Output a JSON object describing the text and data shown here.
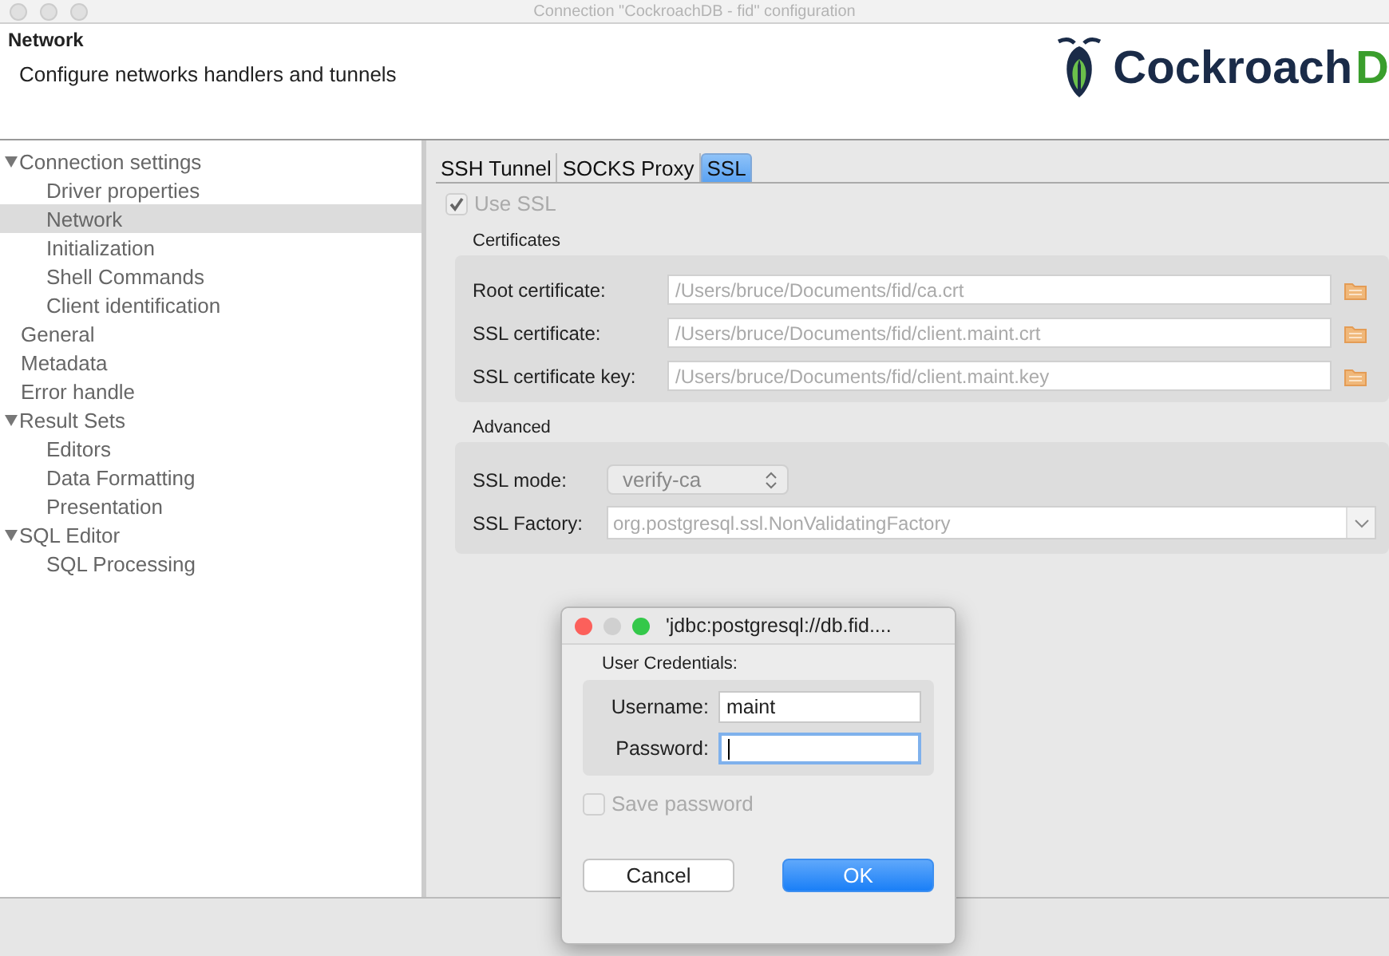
{
  "window": {
    "title": "Connection \"CockroachDB - fid\" configuration"
  },
  "header": {
    "title": "Network",
    "subtitle": "Configure networks handlers and tunnels",
    "logo": {
      "name": "Cockroach",
      "suffix": "D"
    }
  },
  "sidebar": {
    "items": [
      {
        "label": "Connection settings",
        "expanded": true,
        "selected": false,
        "children": [
          {
            "label": "Driver properties",
            "selected": false
          },
          {
            "label": "Network",
            "selected": true
          },
          {
            "label": "Initialization",
            "selected": false
          },
          {
            "label": "Shell Commands",
            "selected": false
          },
          {
            "label": "Client identification",
            "selected": false
          }
        ]
      },
      {
        "label": "General",
        "selected": false
      },
      {
        "label": "Metadata",
        "selected": false
      },
      {
        "label": "Error handle",
        "selected": false
      },
      {
        "label": "Result Sets",
        "expanded": true,
        "selected": false,
        "children": [
          {
            "label": "Editors",
            "selected": false
          },
          {
            "label": "Data Formatting",
            "selected": false
          },
          {
            "label": "Presentation",
            "selected": false
          }
        ]
      },
      {
        "label": "SQL Editor",
        "expanded": true,
        "selected": false,
        "children": [
          {
            "label": "SQL Processing",
            "selected": false
          }
        ]
      }
    ]
  },
  "tabs": [
    {
      "label": "SSH Tunnel",
      "selected": false
    },
    {
      "label": "SOCKS Proxy",
      "selected": false
    },
    {
      "label": "SSL",
      "selected": true
    }
  ],
  "use_ssl": {
    "label": "Use SSL",
    "checked": true,
    "disabled": true
  },
  "certificates": {
    "title": "Certificates",
    "fields": [
      {
        "label": "Root certificate:",
        "value": "/Users/bruce/Documents/fid/ca.crt"
      },
      {
        "label": "SSL certificate:",
        "value": "/Users/bruce/Documents/fid/client.maint.crt"
      },
      {
        "label": "SSL certificate key:",
        "value": "/Users/bruce/Documents/fid/client.maint.key"
      }
    ]
  },
  "advanced": {
    "title": "Advanced",
    "ssl_mode": {
      "label": "SSL mode:",
      "value": "verify-ca"
    },
    "ssl_factory": {
      "label": "SSL Factory:",
      "value": "org.postgresql.ssl.NonValidatingFactory"
    }
  },
  "dialog": {
    "title": "'jdbc:postgresql://db.fid....",
    "group": "User Credentials:",
    "username": {
      "label": "Username:",
      "value": "maint"
    },
    "password": {
      "label": "Password:",
      "focused": true
    },
    "save_password": {
      "label": "Save password",
      "checked": false,
      "disabled": true
    },
    "buttons": [
      {
        "label": "Cancel",
        "default": false
      },
      {
        "label": "OK",
        "default": true
      }
    ]
  }
}
